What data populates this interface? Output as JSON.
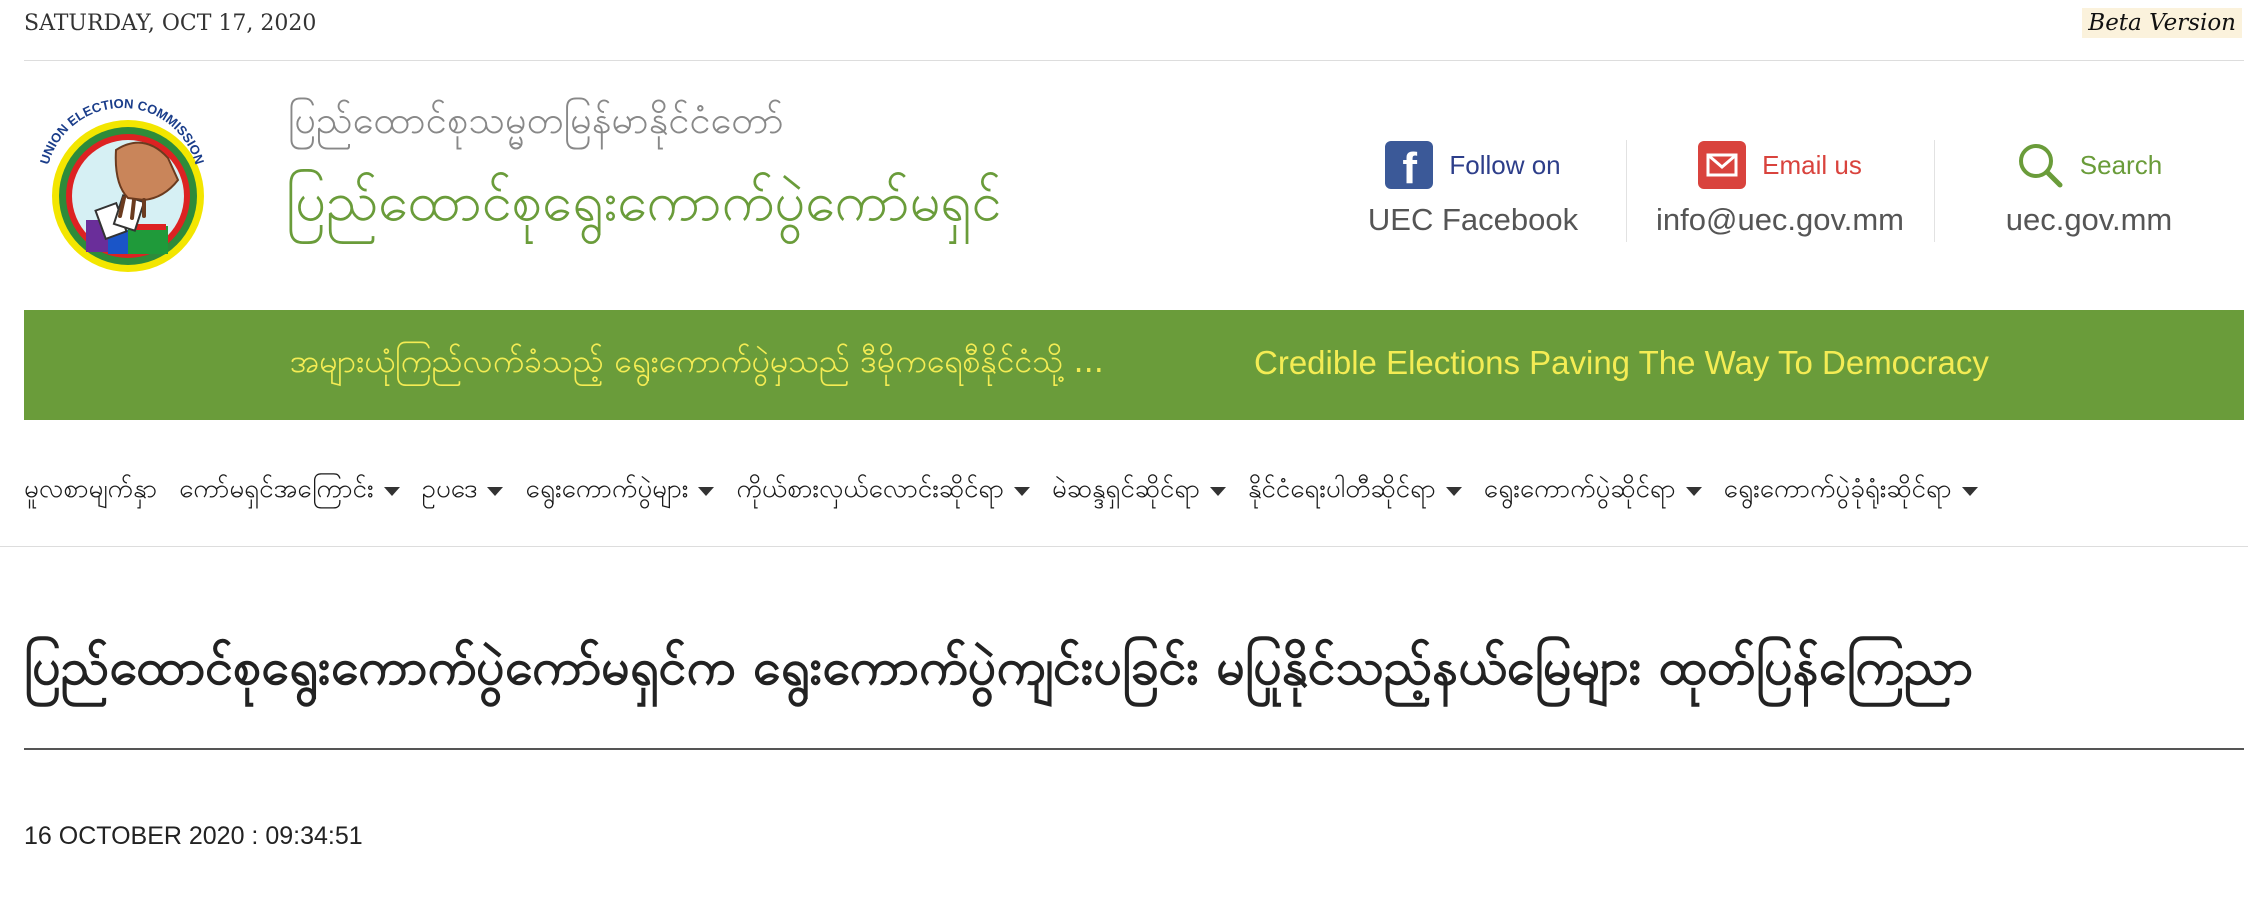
{
  "topbar": {
    "date": "SATURDAY, OCT 17, 2020",
    "beta": "Beta Version"
  },
  "header": {
    "logo_text": "UNION ELECTION COMMISSION",
    "subtitle": "ပြည်ထောင်စုသမ္မတမြန်မာနိုင်ငံတော်",
    "title": "ပြည်ထောင်စုရွေးကောက်ပွဲကော်မရှင်",
    "links": [
      {
        "label": "Follow on",
        "value": "UEC Facebook",
        "icon": "facebook-icon",
        "color": "#2d3e8a"
      },
      {
        "label": "Email us",
        "value": "info@uec.gov.mm",
        "icon": "mail-icon",
        "color": "#d9433d"
      },
      {
        "label": "Search",
        "value": "uec.gov.mm",
        "icon": "search-icon",
        "color": "#6a9c3a"
      }
    ]
  },
  "banner": {
    "mm": "အများယုံကြည်လက်ခံသည့် ရွေးကောက်ပွဲမှသည် ဒီမိုကရေစီနိုင်ငံသို့ ...",
    "en": "Credible Elections Paving The Way To Democracy"
  },
  "nav": [
    {
      "label": "မူလစာမျက်နှာ",
      "dropdown": false
    },
    {
      "label": "ကော်မရှင်အကြောင်း",
      "dropdown": true
    },
    {
      "label": "ဥပဒေ",
      "dropdown": true
    },
    {
      "label": "ရွေးကောက်ပွဲများ",
      "dropdown": true
    },
    {
      "label": "ကိုယ်စားလှယ်လောင်းဆိုင်ရာ",
      "dropdown": true
    },
    {
      "label": "မဲဆန္ဒရှင်ဆိုင်ရာ",
      "dropdown": true
    },
    {
      "label": "နိုင်ငံရေးပါတီဆိုင်ရာ",
      "dropdown": true
    },
    {
      "label": "ရွေးကောက်ပွဲဆိုင်ရာ",
      "dropdown": true
    },
    {
      "label": "ရွေးကောက်ပွဲခုံရုံးဆိုင်ရာ",
      "dropdown": true
    }
  ],
  "article": {
    "headline": "ပြည်ထောင်စုရွေးကောက်ပွဲကော်မရှင်က ရွေးကောက်ပွဲကျင်းပခြင်း မပြုနိုင်သည့်နယ်မြေများ ထုတ်ပြန်ကြေညာ",
    "date": "16 OCTOBER 2020 : 09:34:51"
  },
  "colors": {
    "brand_green": "#6a9c3a",
    "banner_text": "#f4ec54",
    "facebook_blue": "#3b5998",
    "email_red": "#d9433d"
  }
}
